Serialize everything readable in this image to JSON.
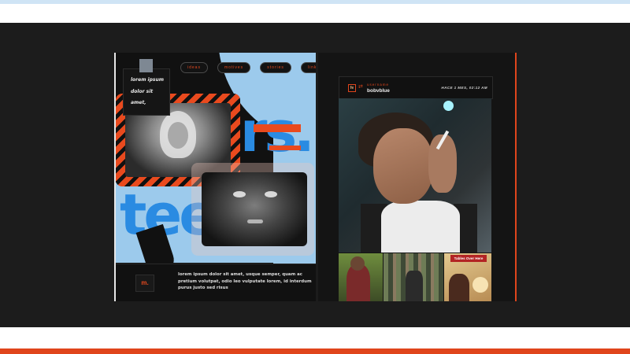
{
  "left_panel": {
    "nav": [
      "ideas",
      "motives",
      "stories",
      "links"
    ],
    "caption": [
      "lorem ipsum",
      "dolor sit",
      "amet,"
    ],
    "big_text_top": "rs.",
    "big_text_bottom": "tee",
    "footer": {
      "logo": "m.",
      "paragraph": "lorem ipsum dolor sit amet, usque semper, quam ac pretium volutpat, odio leo vulputate lorem, id interdum purus justo sed risus"
    }
  },
  "right_panel": {
    "header": {
      "avatar": "fe",
      "username_label": "username",
      "username": "bobvblue",
      "timestamp": "HACE 1 MES,  02:12 AM"
    },
    "thumb_sign": "Tables Over Here"
  },
  "colors": {
    "accent": "#e0451c",
    "blue": "#2a8be2",
    "light_blue": "#9ccaec",
    "background": "#1c1c1c"
  }
}
